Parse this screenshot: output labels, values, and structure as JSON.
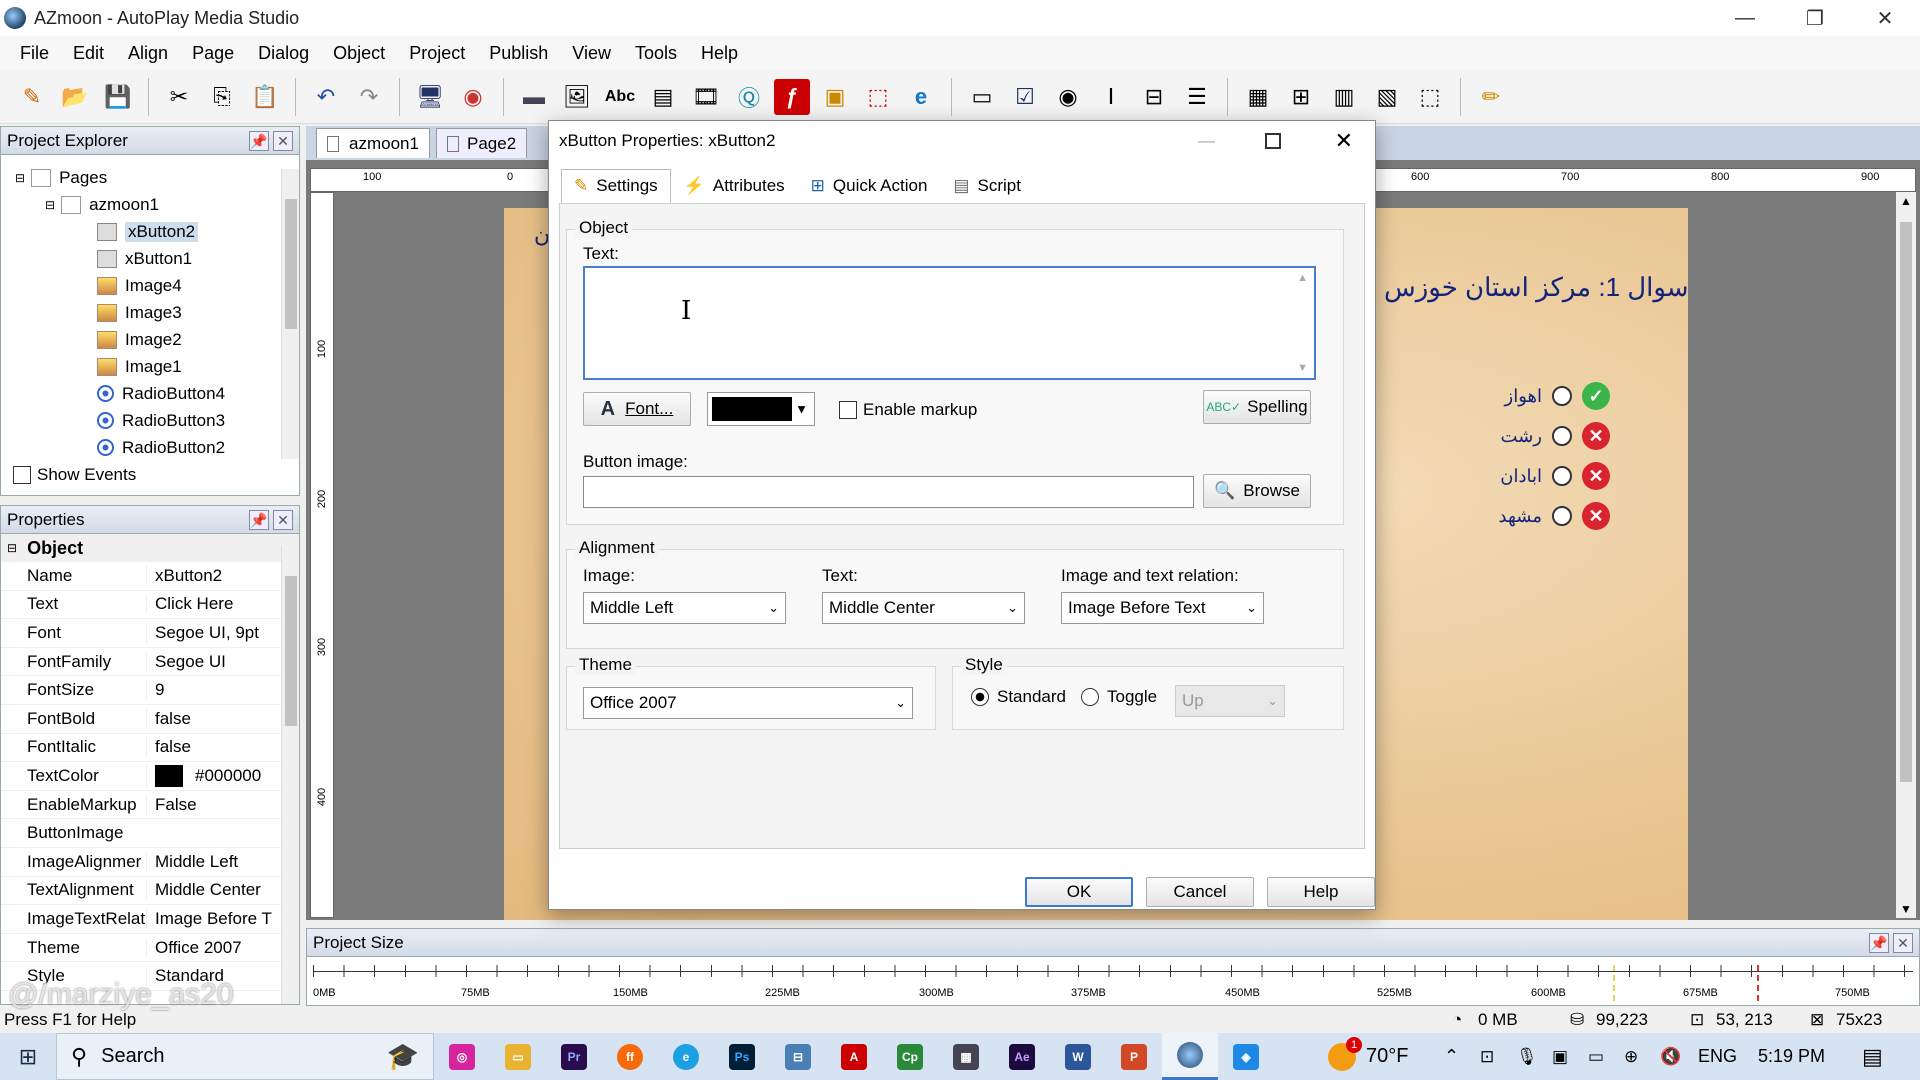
{
  "window": {
    "title": "AZmoon - AutoPlay Media Studio",
    "min": "—",
    "max": "❐",
    "close": "✕"
  },
  "menu": [
    "File",
    "Edit",
    "Align",
    "Page",
    "Dialog",
    "Object",
    "Project",
    "Publish",
    "View",
    "Tools",
    "Help"
  ],
  "project_explorer": {
    "title": "Project Explorer",
    "items": [
      {
        "label": "Pages",
        "icon": "pages-icon"
      },
      {
        "label": "azmoon1",
        "icon": "page-icon"
      },
      {
        "label": "xButton2",
        "icon": "button-icon"
      },
      {
        "label": "xButton1",
        "icon": "button-icon"
      },
      {
        "label": "Image4",
        "icon": "image-icon"
      },
      {
        "label": "Image3",
        "icon": "image-icon"
      },
      {
        "label": "Image2",
        "icon": "image-icon"
      },
      {
        "label": "Image1",
        "icon": "image-icon"
      },
      {
        "label": "RadioButton4",
        "icon": "radio-icon"
      },
      {
        "label": "RadioButton3",
        "icon": "radio-icon"
      },
      {
        "label": "RadioButton2",
        "icon": "radio-icon"
      }
    ],
    "show_events": "Show Events"
  },
  "properties": {
    "title": "Properties",
    "section": "Object",
    "rows": [
      {
        "k": "Name",
        "v": "xButton2"
      },
      {
        "k": "Text",
        "v": "Click Here"
      },
      {
        "k": "Font",
        "v": "Segoe UI, 9pt"
      },
      {
        "k": "FontFamily",
        "v": "Segoe UI"
      },
      {
        "k": "FontSize",
        "v": "9"
      },
      {
        "k": "FontBold",
        "v": "false"
      },
      {
        "k": "FontItalic",
        "v": "false"
      },
      {
        "k": "TextColor",
        "v": "#000000"
      },
      {
        "k": "EnableMarkup",
        "v": "False"
      },
      {
        "k": "ButtonImage",
        "v": ""
      },
      {
        "k": "ImageAlignmer",
        "v": "Middle Left"
      },
      {
        "k": "TextAlignment",
        "v": "Middle Center"
      },
      {
        "k": "ImageTextRelati",
        "v": "Image Before T"
      },
      {
        "k": "Theme",
        "v": "Office 2007"
      },
      {
        "k": "Style",
        "v": "Standard"
      }
    ]
  },
  "doc_tabs": [
    "azmoon1",
    "Page2"
  ],
  "ruler_h": [
    "100",
    "0",
    "600",
    "700",
    "800",
    "900"
  ],
  "ruler_v": [
    "100",
    "200",
    "300",
    "400"
  ],
  "page_content": {
    "question": "سوال 1: مرکز استان خوزس",
    "partial": "ن",
    "options": [
      {
        "text": "اهواز",
        "mark": "check",
        "color": "#3bb54a"
      },
      {
        "text": "رشت",
        "mark": "x",
        "color": "#d9232e"
      },
      {
        "text": "ابادان",
        "mark": "x",
        "color": "#d9232e"
      },
      {
        "text": "مشهد",
        "mark": "x",
        "color": "#d9232e"
      }
    ]
  },
  "dialog": {
    "title": "xButton Properties: xButton2",
    "tabs": [
      "Settings",
      "Attributes",
      "Quick Action",
      "Script"
    ],
    "object_group": "Object",
    "text_label": "Text:",
    "text_value": "",
    "font_button": "Font...",
    "text_color": "#000000",
    "enable_markup": "Enable markup",
    "spelling_button": "Spelling",
    "button_image_label": "Button image:",
    "button_image_value": "",
    "browse_button": "Browse",
    "alignment_group": "Alignment",
    "image_label": "Image:",
    "image_value": "Middle Left",
    "text_align_label": "Text:",
    "text_align_value": "Middle Center",
    "relation_label": "Image and text relation:",
    "relation_value": "Image Before Text",
    "theme_group": "Theme",
    "theme_value": "Office 2007",
    "style_group": "Style",
    "style_standard": "Standard",
    "style_toggle": "Toggle",
    "style_state": "Up",
    "ok": "OK",
    "cancel": "Cancel",
    "help": "Help"
  },
  "project_size": {
    "title": "Project Size",
    "marks": [
      "0MB",
      "75MB",
      "150MB",
      "225MB",
      "300MB",
      "375MB",
      "450MB",
      "525MB",
      "600MB",
      "675MB",
      "750MB"
    ]
  },
  "watermark": "@/marziye_as20",
  "status": {
    "help": "Press F1 for Help",
    "mem": "0 MB",
    "size": "99,223",
    "pos": "53, 213",
    "dim": "75x23"
  },
  "taskbar": {
    "search": "Search",
    "weather": "70°F",
    "lang": "ENG",
    "time": "5:19 PM",
    "badge": "1"
  }
}
